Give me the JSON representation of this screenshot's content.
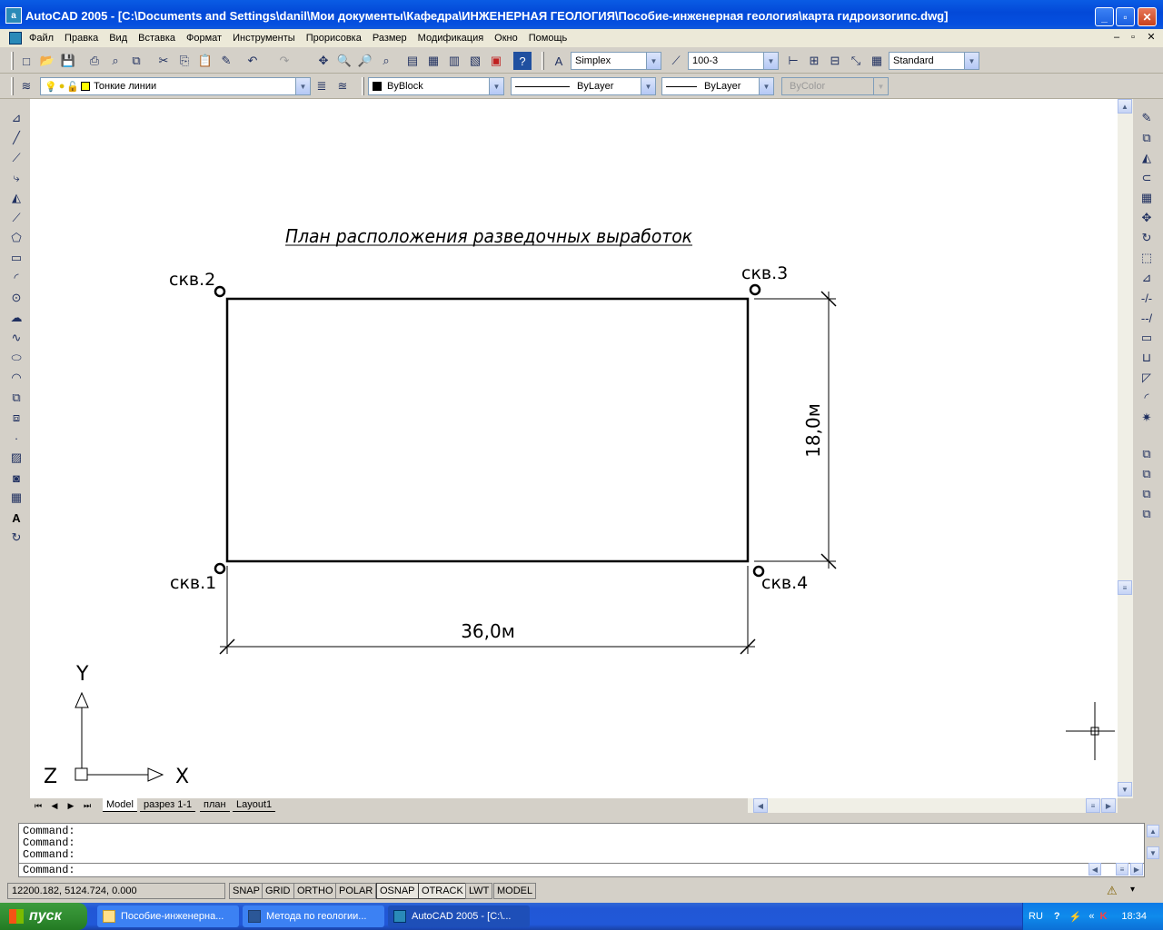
{
  "window": {
    "title": "AutoCAD 2005 - [C:\\Documents and Settings\\danil\\Мои документы\\Кафедра\\ИНЖЕНЕРНАЯ ГЕОЛОГИЯ\\Пособие-инженерная геология\\карта гидроизогипс.dwg]",
    "icon_label": "a"
  },
  "menu": [
    "Файл",
    "Правка",
    "Вид",
    "Вставка",
    "Формат",
    "Инструменты",
    "Прорисовка",
    "Размер",
    "Модификация",
    "Окно",
    "Помощь"
  ],
  "toolbars": {
    "text_style": "Simplex",
    "dim_style": "100-3",
    "table_style": "Standard",
    "layer": "Тонкие линии",
    "color": "ByBlock",
    "linetype": "ByLayer",
    "lineweight": "ByLayer",
    "plotstyle": "ByColor"
  },
  "drawing": {
    "title": "План расположения разведочных выработок",
    "wells": [
      "скв.1",
      "скв.2",
      "скв.3",
      "скв.4"
    ],
    "dim_width": "36,0м",
    "dim_height": "18,0м",
    "ucs": {
      "x": "X",
      "y": "Y",
      "z": "Z"
    }
  },
  "tabs": [
    "Model",
    "разрез 1-1",
    "план",
    "Layout1"
  ],
  "command": {
    "history": [
      "Command:",
      "Command:",
      "Command:"
    ],
    "prompt": "Command:"
  },
  "status": {
    "coords": "12200.182, 5124.724, 0.000",
    "toggles": [
      "SNAP",
      "GRID",
      "ORTHO",
      "POLAR",
      "OSNAP",
      "OTRACK",
      "LWT",
      "MODEL"
    ]
  },
  "taskbar": {
    "start": "пуск",
    "tasks": [
      "Пособие-инженерна...",
      "Метода по геологии...",
      "AutoCAD 2005 - [C:\\..."
    ],
    "lang": "RU",
    "time": "18:34"
  }
}
